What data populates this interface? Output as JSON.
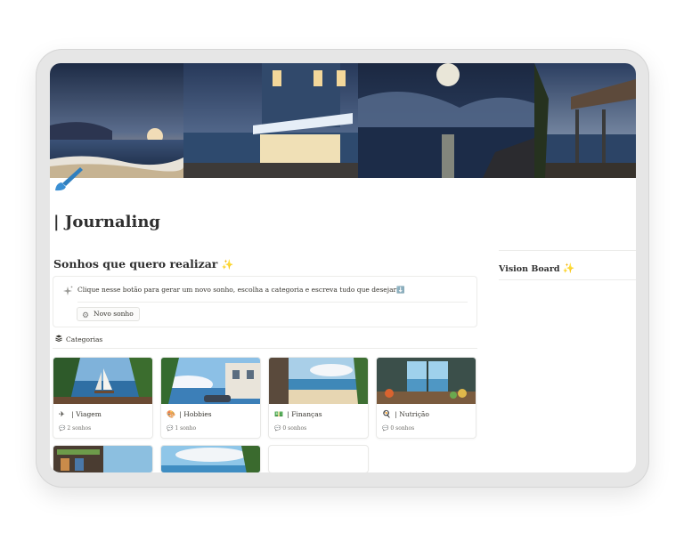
{
  "page": {
    "title": "| Journaling",
    "icon": "brush-icon"
  },
  "dreams": {
    "heading": "Sonhos que quero realizar",
    "sparkle": "✨",
    "callout_text": "Clique nesse botão para gerar um novo sonho, escolha a categoria e escreva tudo que desejar⬇️",
    "new_button_label": "Novo sonho"
  },
  "categories": {
    "header": "Categorias",
    "cards": [
      {
        "icon": "✈",
        "title": "| Viagem",
        "count": "2 sonhos"
      },
      {
        "icon": "🎨",
        "title": "| Hobbies",
        "count": "1 sonho"
      },
      {
        "icon": "💵",
        "title": "| Finanças",
        "count": "0 sonhos"
      },
      {
        "icon": "🍳",
        "title": "| Nutrição",
        "count": "0 sonhos"
      }
    ]
  },
  "vision_board": {
    "heading": "Vision Board",
    "sparkle": "✨"
  },
  "colors": {
    "accent_brush": "#2f7fbf",
    "text": "#37352f"
  }
}
